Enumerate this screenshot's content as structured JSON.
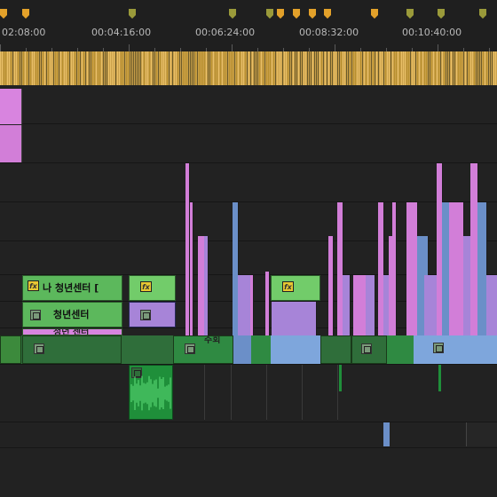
{
  "timeline": {
    "timecodes": [
      "02:08:00",
      "00:04:16:00",
      "00:06:24:00",
      "00:08:32:00",
      "00:10:40:00"
    ]
  },
  "markers": {
    "colors": {
      "green": "#9a9a3a",
      "orange": "#e3a12a"
    },
    "list": [
      {
        "color": "orange"
      },
      {
        "color": "orange"
      },
      {
        "color": "green"
      },
      {
        "color": "green"
      },
      {
        "color": "green"
      },
      {
        "color": "orange"
      },
      {
        "color": "orange"
      },
      {
        "color": "orange"
      },
      {
        "color": "orange"
      },
      {
        "color": "orange"
      },
      {
        "color": "green"
      },
      {
        "color": "green"
      },
      {
        "color": "green"
      }
    ]
  },
  "clips": {
    "title_1": "나 청년센터 [",
    "title_2": "청년센터",
    "title_3": "청년 센터",
    "title_partial": "주회",
    "fx_label": "fx"
  },
  "colors": {
    "pink": "#d27ed8",
    "green_clip": "#5cb85c",
    "light_green": "#72cc6a",
    "violet": "#a784d8",
    "blue": "#6b8fc8",
    "dark_green": "#2f6e3a",
    "audio_green": "#1f8f3a",
    "workbar": "#caa04a"
  }
}
